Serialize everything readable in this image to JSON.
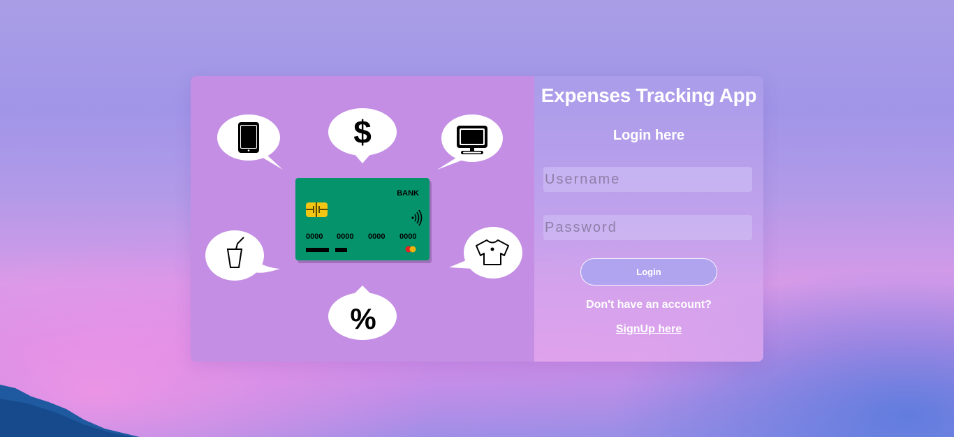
{
  "login": {
    "app_title": "Expenses Tracking App",
    "heading": "Login here",
    "username_placeholder": "Username",
    "username_value": "",
    "password_placeholder": "Password",
    "password_value": "",
    "login_button": "Login",
    "no_account_text": "Don't have an account?",
    "signup_link": "SignUp here"
  },
  "illustration": {
    "bank_label": "BANK",
    "card_number_groups": [
      "0000",
      "0000",
      "0000",
      "0000"
    ],
    "dollar_symbol": "$",
    "percent_symbol": "%",
    "bubble_icons": [
      "phone-icon",
      "dollar-icon",
      "monitor-icon",
      "drink-cup-icon",
      "tshirt-icon",
      "percent-icon"
    ],
    "card_color": "#04936b",
    "chip_color": "#f3c614"
  },
  "colors": {
    "left_panel": "#c38ee3",
    "button": "#aaa5f0",
    "text": "#ffffff"
  }
}
